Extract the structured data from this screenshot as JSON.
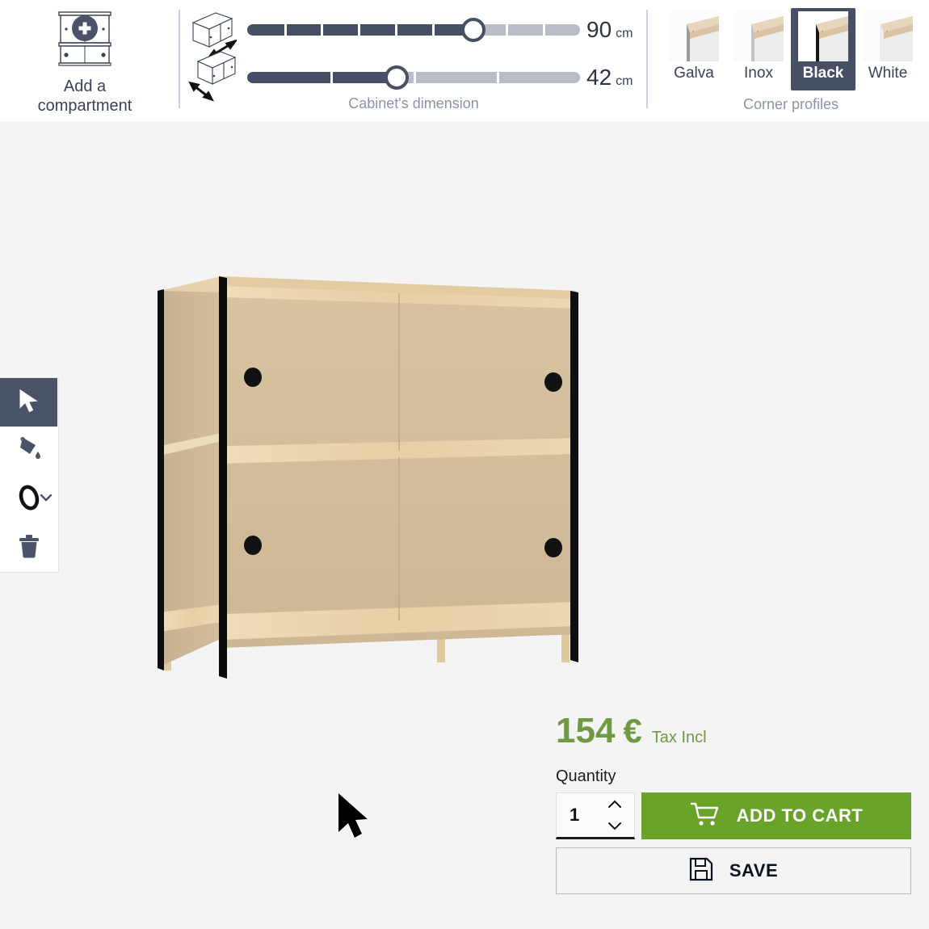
{
  "header": {
    "add_compartment": {
      "label": "Add a\ncompartment",
      "icon": "add-compartment-icon"
    },
    "dimensions": {
      "caption": "Cabinet's dimension",
      "sliders": [
        {
          "name": "width",
          "value": "90",
          "unit": "cm",
          "percent": 68,
          "segments": 9,
          "icon": "cabinet-width-arrow-icon"
        },
        {
          "name": "height",
          "value": "42",
          "unit": "cm",
          "percent": 45,
          "segments": 4,
          "icon": "cabinet-height-arrow-icon"
        }
      ]
    },
    "corner_profiles": {
      "caption": "Corner profiles",
      "selected": "Black",
      "options": [
        {
          "label": "Galva",
          "color": "#9a9a9f",
          "selected": false
        },
        {
          "label": "Inox",
          "color": "#c3c3c6",
          "selected": false
        },
        {
          "label": "Black",
          "color": "#15161a",
          "selected": true
        },
        {
          "label": "White",
          "color": "#efefef",
          "selected": false
        }
      ]
    }
  },
  "toolbar": {
    "tools": [
      {
        "name": "select-tool",
        "icon": "cursor-arrow-icon",
        "active": true
      },
      {
        "name": "paint-tool",
        "icon": "paint-bucket-icon",
        "active": false
      },
      {
        "name": "handle-tool",
        "icon": "knob-handle-icon",
        "active": false,
        "has_dropdown": true
      },
      {
        "name": "delete-tool",
        "icon": "trash-icon",
        "active": false
      }
    ]
  },
  "canvas": {
    "product": "cabinet-3d-preview",
    "cursor": "mouse-pointer"
  },
  "purchase": {
    "price_amount": "154",
    "price_currency": "€",
    "price_tax_note": "Tax Incl",
    "price_color": "#6d9a43",
    "quantity_label": "Quantity",
    "quantity_value": "1",
    "add_to_cart_label": "ADD TO CART",
    "add_to_cart_color": "#6aa32a",
    "save_label": "SAVE"
  }
}
